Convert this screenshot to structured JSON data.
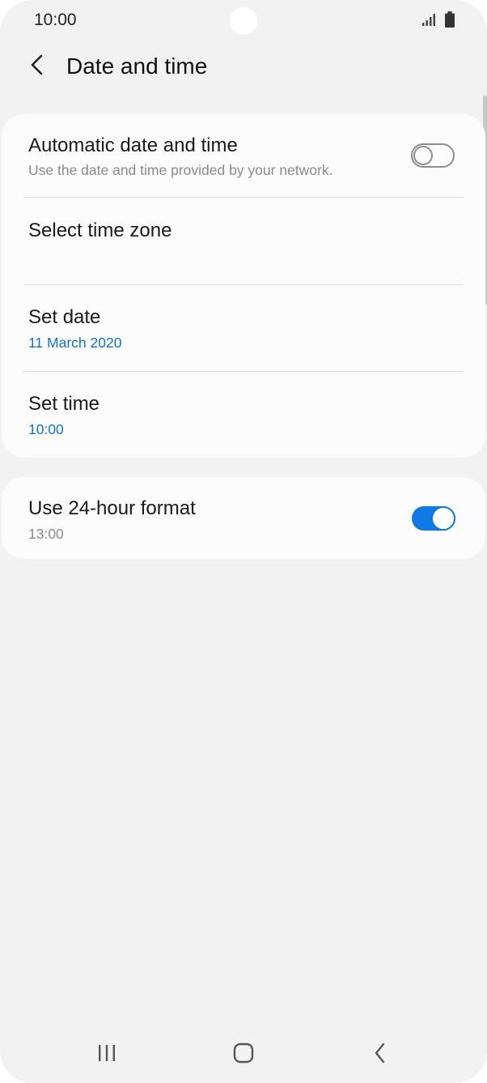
{
  "status_bar": {
    "time": "10:00",
    "icons": [
      "signal-icon",
      "battery-icon"
    ]
  },
  "header": {
    "title": "Date and time",
    "back_icon": "chevron-left-icon"
  },
  "settings": {
    "automatic": {
      "title": "Automatic date and time",
      "subtitle": "Use the date and time provided by your network.",
      "enabled": false
    },
    "time_zone": {
      "title": "Select time zone"
    },
    "set_date": {
      "title": "Set date",
      "value": "11 March 2020"
    },
    "set_time": {
      "title": "Set time",
      "value": "10:00"
    },
    "format_24h": {
      "title": "Use 24-hour format",
      "subtitle": "13:00",
      "enabled": true
    }
  },
  "nav_bar": {
    "icons": [
      "recents-icon",
      "home-icon",
      "back-icon"
    ]
  },
  "colors": {
    "accent": "#0f7ae6",
    "link_text": "#0f74c8",
    "background": "#f2f2f2",
    "card": "#fcfcfc"
  }
}
